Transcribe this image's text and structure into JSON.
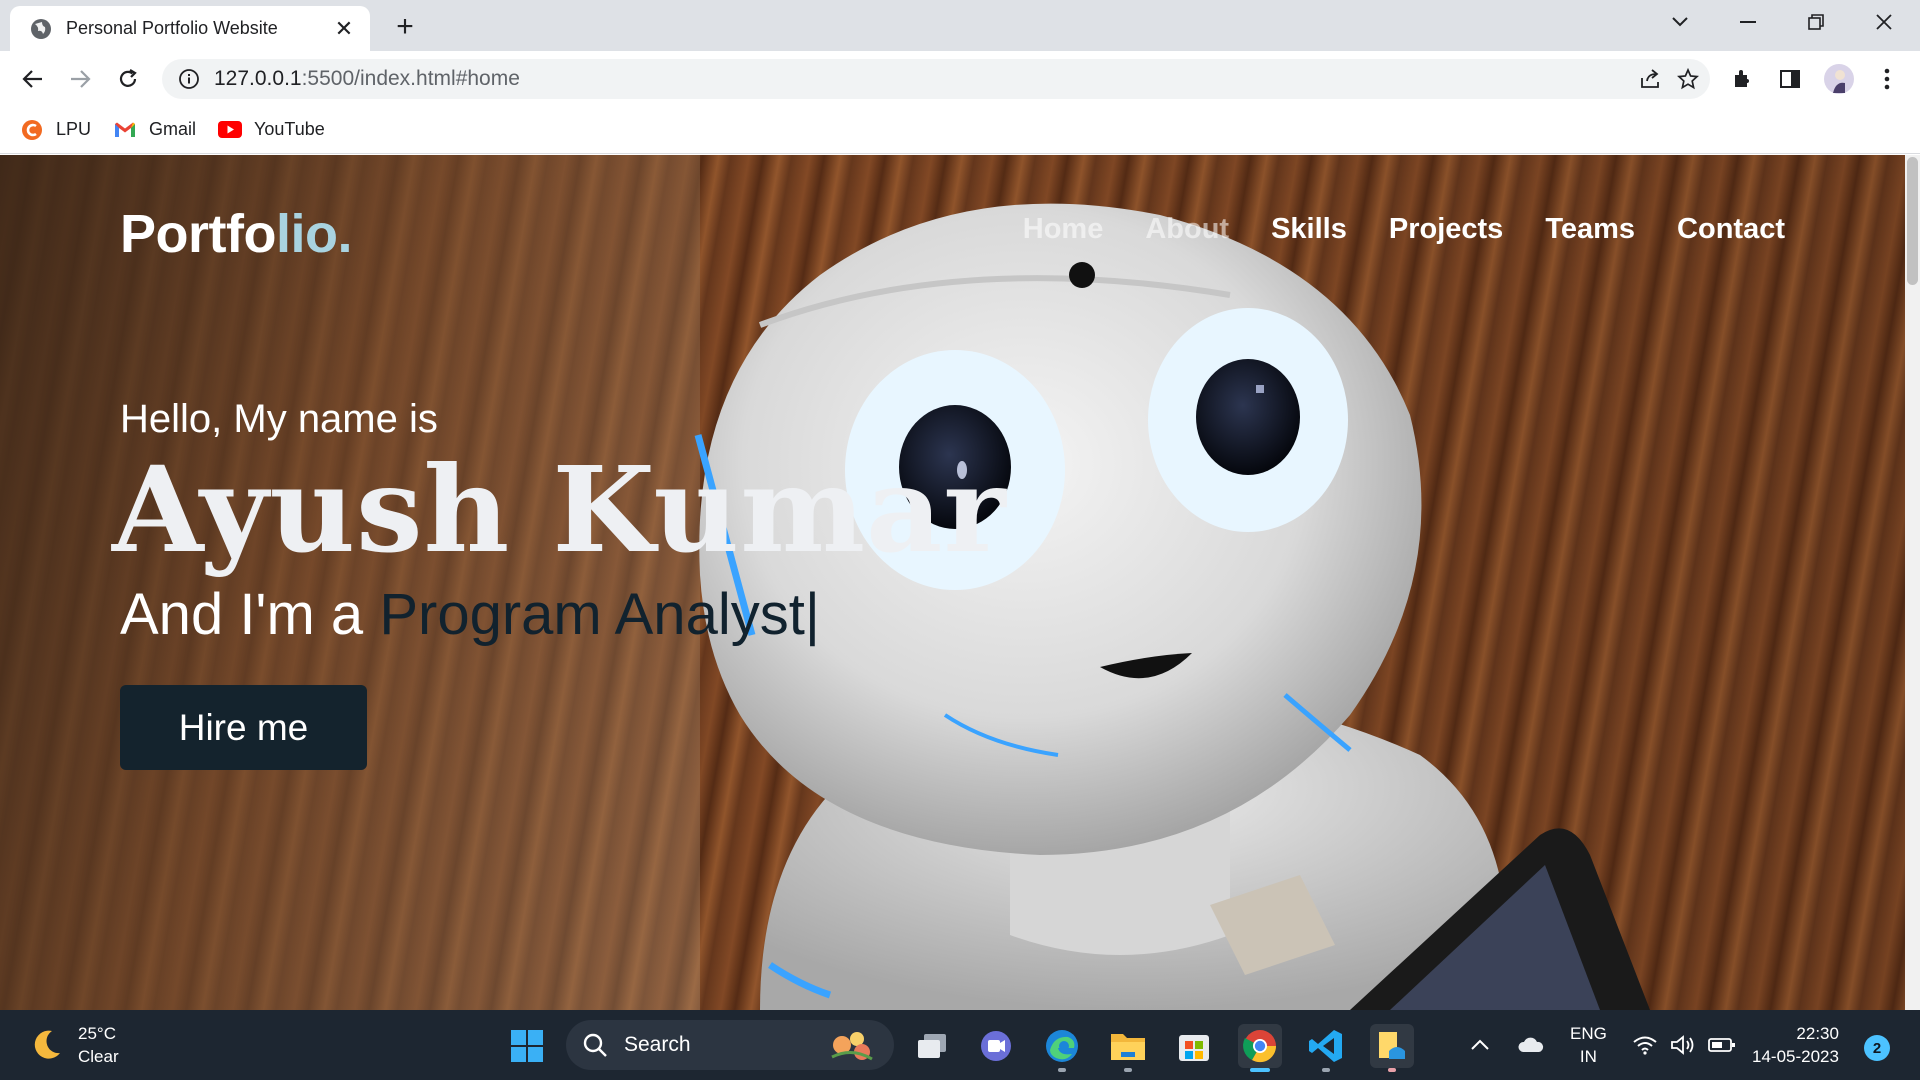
{
  "browser": {
    "tab_title": "Personal Portfolio Website",
    "url_host": "127.0.0.1",
    "url_rest": ":5500/index.html#home",
    "bookmarks": [
      {
        "label": "LPU",
        "icon": "lpu-icon"
      },
      {
        "label": "Gmail",
        "icon": "gmail-icon"
      },
      {
        "label": "YouTube",
        "icon": "youtube-icon"
      }
    ]
  },
  "page": {
    "logo_main": "Portfo",
    "logo_accent": "lio.",
    "nav": [
      "Home",
      "About",
      "Skills",
      "Projects",
      "Teams",
      "Contact"
    ],
    "hello": "Hello, My name is",
    "name": "Ayush Kumar",
    "role_prefix": "And I'm a ",
    "role_typed": "Program Analyst",
    "cursor": "|",
    "hire_label": "Hire me"
  },
  "taskbar": {
    "temperature": "25°C",
    "weather": "Clear",
    "search_label": "Search",
    "lang_1": "ENG",
    "lang_2": "IN",
    "time": "22:30",
    "date": "14-05-2023",
    "notifications": "2"
  },
  "colors": {
    "accent": "#a9d3e0",
    "button_bg": "#14232d",
    "taskbar_bg": "#1d2631"
  }
}
